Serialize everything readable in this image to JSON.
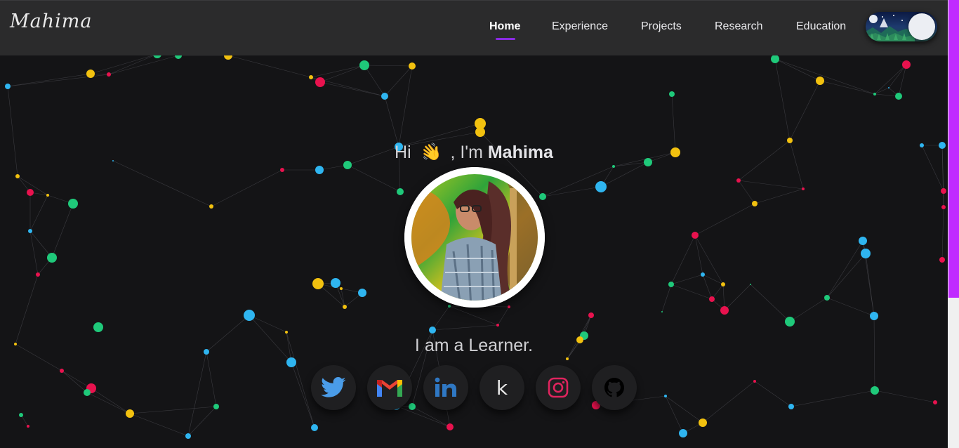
{
  "brand": {
    "logo_text": "Mahima"
  },
  "nav": {
    "items": [
      {
        "label": "Home",
        "active": true
      },
      {
        "label": "Experience",
        "active": false
      },
      {
        "label": "Projects",
        "active": false
      },
      {
        "label": "Research",
        "active": false
      },
      {
        "label": "Education",
        "active": false
      }
    ],
    "accent_color": "#8a2be2"
  },
  "theme_toggle": {
    "state": "dark",
    "icon": "night-mountain-icon"
  },
  "hero": {
    "greeting_prefix": "Hi",
    "greeting_emoji": "👋",
    "greeting_middle": ", I'm",
    "name": "Mahima",
    "tagline": "I am a Learner."
  },
  "social_links": [
    {
      "name": "twitter",
      "icon": "twitter-icon",
      "color": "#4a9ce8"
    },
    {
      "name": "gmail",
      "icon": "gmail-icon",
      "color": "#ea4335"
    },
    {
      "name": "linkedin",
      "icon": "linkedin-icon",
      "color": "#2f78c4"
    },
    {
      "name": "kaggle",
      "icon": "kaggle-icon",
      "label": "k",
      "color": "#e5e5e5"
    },
    {
      "name": "instagram",
      "icon": "instagram-icon",
      "color": "#e0245e"
    },
    {
      "name": "github",
      "icon": "github-icon",
      "color": "#000000"
    }
  ],
  "colors": {
    "background": "#141416",
    "navbar": "#2b2b2c",
    "scrollbar_thumb": "#c02bff",
    "particles": [
      "#1fc97a",
      "#f2c10f",
      "#e8124e",
      "#2fb5f0"
    ]
  }
}
